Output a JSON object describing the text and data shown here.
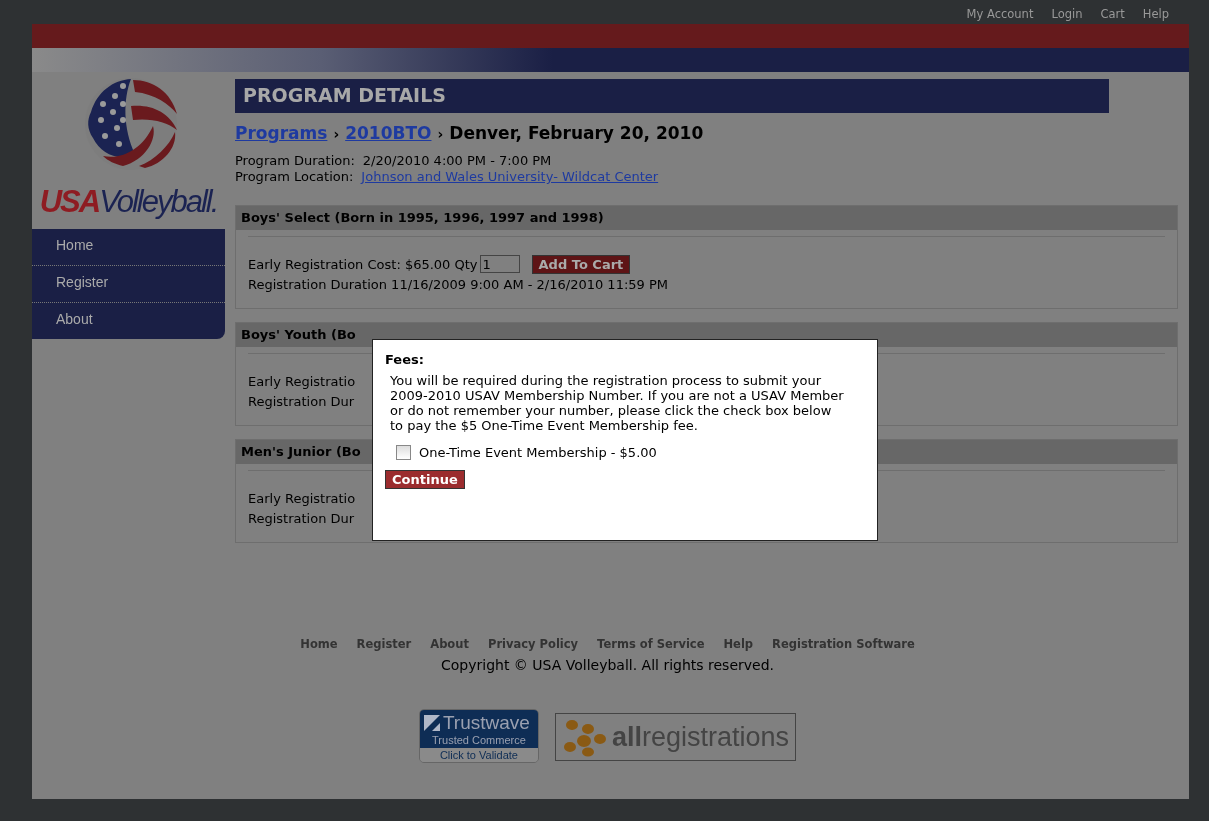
{
  "top_links": [
    "My Account",
    "Login",
    "Cart",
    "Help"
  ],
  "logo": {
    "text_1": "USA",
    "text_2": "Volleyball."
  },
  "nav": [
    "Home",
    "Register",
    "About"
  ],
  "page_title": "PROGRAM DETAILS",
  "breadcrumb": {
    "links": [
      "Programs",
      "2010BTO"
    ],
    "separator": "›",
    "current": "Denver, February 20, 2010"
  },
  "program": {
    "duration_label": "Program Duration:",
    "duration": "2/20/2010 4:00 PM - 7:00 PM",
    "location_label": "Program Location:",
    "location": "Johnson and Wales University- Wildcat Center"
  },
  "sections": [
    {
      "title": "Boys' Select (Born in 1995, 1996, 1997 and 1998)",
      "cost": "Early Registration Cost: $65.00 Qty",
      "qty": "1",
      "add_button": "Add To Cart",
      "duration": "Registration Duration  11/16/2009 9:00 AM - 2/16/2010 11:59 PM"
    },
    {
      "title": "Boys' Youth (Bo",
      "cost": "Early Registratio",
      "duration": "Registration Dur"
    },
    {
      "title": "Men's Junior (Bo",
      "cost": "Early Registratio",
      "duration": "Registration Dur"
    }
  ],
  "modal": {
    "title": "Fees:",
    "text": "You will be required during the registration process to submit your 2009-2010 USAV Membership Number. If you are not a USAV Member or do not remember your number, please click the check box below to pay the $5 One-Time Event Membership fee.",
    "checkbox_label": "One-Time Event Membership - $5.00",
    "checked": false,
    "button": "Continue"
  },
  "footer_links": [
    "Home",
    "Register",
    "About",
    "Privacy Policy",
    "Terms of Service",
    "Help",
    "Registration Software"
  ],
  "copyright": "Copyright © USA Volleyball. All rights reserved.",
  "badges": {
    "trustwave": {
      "name": "Trustwave",
      "line_1": "Trusted Commerce",
      "line_2": "Click to Validate"
    },
    "allregistrations": {
      "bold": "all",
      "rest": "registrations"
    }
  }
}
